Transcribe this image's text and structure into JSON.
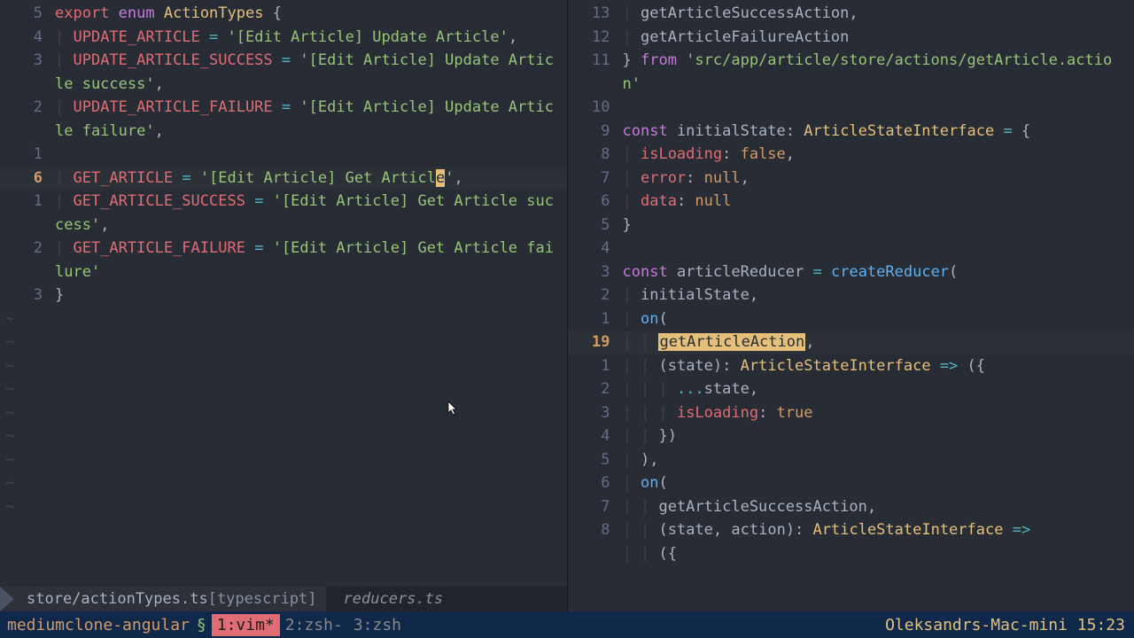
{
  "left": {
    "lines": [
      {
        "n": "5",
        "cur": false,
        "tokens": [
          [
            "kw-export",
            "export"
          ],
          [
            "punct",
            " "
          ],
          [
            "kw-enum",
            "enum"
          ],
          [
            "punct",
            " "
          ],
          [
            "type-name",
            "ActionTypes"
          ],
          [
            "punct",
            " {"
          ]
        ]
      },
      {
        "n": "4",
        "cur": false,
        "indent": 1,
        "tokens": [
          [
            "member",
            "UPDATE_ARTICLE"
          ],
          [
            "punct",
            " "
          ],
          [
            "op",
            "="
          ],
          [
            "punct",
            " "
          ],
          [
            "string",
            "'[Edit Article] Update Article'"
          ],
          [
            "punct",
            ","
          ]
        ]
      },
      {
        "n": "3",
        "cur": false,
        "indent": 1,
        "tokens": [
          [
            "member",
            "UPDATE_ARTICLE_SUCCESS"
          ],
          [
            "punct",
            " "
          ],
          [
            "op",
            "="
          ],
          [
            "punct",
            " "
          ],
          [
            "string",
            "'[Edit Article] Update Article success'"
          ],
          [
            "punct",
            ","
          ]
        ]
      },
      {
        "n": "2",
        "cur": false,
        "indent": 1,
        "tokens": [
          [
            "member",
            "UPDATE_ARTICLE_FAILURE"
          ],
          [
            "punct",
            " "
          ],
          [
            "op",
            "="
          ],
          [
            "punct",
            " "
          ],
          [
            "string",
            "'[Edit Article] Update Article failure'"
          ],
          [
            "punct",
            ","
          ]
        ]
      },
      {
        "n": "1",
        "cur": false,
        "indent": 0,
        "tokens": []
      },
      {
        "n": "6",
        "cur": true,
        "indent": 1,
        "tokens": [
          [
            "member",
            "GET_ARTICLE"
          ],
          [
            "punct",
            " "
          ],
          [
            "op",
            "="
          ],
          [
            "punct",
            " "
          ],
          [
            "string",
            "'[Edit Article] Get Articl"
          ],
          [
            "highlight-char",
            "e"
          ],
          [
            "string",
            "'"
          ],
          [
            "punct",
            ","
          ]
        ]
      },
      {
        "n": "1",
        "cur": false,
        "indent": 1,
        "tokens": [
          [
            "member",
            "GET_ARTICLE_SUCCESS"
          ],
          [
            "punct",
            " "
          ],
          [
            "op",
            "="
          ],
          [
            "punct",
            " "
          ],
          [
            "string",
            "'[Edit Article] Get Article success'"
          ],
          [
            "punct",
            ","
          ]
        ]
      },
      {
        "n": "2",
        "cur": false,
        "indent": 1,
        "tokens": [
          [
            "member",
            "GET_ARTICLE_FAILURE"
          ],
          [
            "punct",
            " "
          ],
          [
            "op",
            "="
          ],
          [
            "punct",
            " "
          ],
          [
            "string",
            "'[Edit Article] Get Article failure'"
          ]
        ]
      },
      {
        "n": "3",
        "cur": false,
        "indent": 0,
        "tokens": [
          [
            "punct",
            "}"
          ]
        ]
      }
    ],
    "tildes": 9,
    "status_file": "store/actionTypes.ts",
    "status_filetype": "[typescript]"
  },
  "right": {
    "lines": [
      {
        "n": "13",
        "indent": 1,
        "tokens": [
          [
            "ident",
            "getArticleSuccessAction"
          ],
          [
            "punct",
            ","
          ]
        ]
      },
      {
        "n": "12",
        "indent": 1,
        "tokens": [
          [
            "ident",
            "getArticleFailureAction"
          ]
        ]
      },
      {
        "n": "11",
        "indent": 0,
        "tokens": [
          [
            "punct",
            "} "
          ],
          [
            "kw-from",
            "from"
          ],
          [
            "punct",
            " "
          ],
          [
            "string",
            "'src/app/article/store/actions/getArticle.action'"
          ]
        ]
      },
      {
        "n": "10",
        "indent": 0,
        "tokens": []
      },
      {
        "n": "9",
        "indent": 0,
        "tokens": [
          [
            "kw-const",
            "const"
          ],
          [
            "punct",
            " "
          ],
          [
            "ident",
            "initialState"
          ],
          [
            "punct",
            ": "
          ],
          [
            "type-name",
            "ArticleStateInterface"
          ],
          [
            "punct",
            " "
          ],
          [
            "op",
            "="
          ],
          [
            "punct",
            " {"
          ]
        ]
      },
      {
        "n": "8",
        "indent": 1,
        "tokens": [
          [
            "member",
            "isLoading"
          ],
          [
            "punct",
            ": "
          ],
          [
            "kw-false",
            "false"
          ],
          [
            "punct",
            ","
          ]
        ]
      },
      {
        "n": "7",
        "indent": 1,
        "tokens": [
          [
            "member",
            "error"
          ],
          [
            "punct",
            ": "
          ],
          [
            "kw-null",
            "null"
          ],
          [
            "punct",
            ","
          ]
        ]
      },
      {
        "n": "6",
        "indent": 1,
        "tokens": [
          [
            "member",
            "data"
          ],
          [
            "punct",
            ": "
          ],
          [
            "kw-null",
            "null"
          ]
        ]
      },
      {
        "n": "5",
        "indent": 0,
        "tokens": [
          [
            "punct",
            "}"
          ]
        ]
      },
      {
        "n": "4",
        "indent": 0,
        "tokens": []
      },
      {
        "n": "3",
        "indent": 0,
        "tokens": [
          [
            "kw-const",
            "const"
          ],
          [
            "punct",
            " "
          ],
          [
            "ident",
            "articleReducer"
          ],
          [
            "punct",
            " "
          ],
          [
            "op",
            "="
          ],
          [
            "punct",
            " "
          ],
          [
            "func",
            "createReducer"
          ],
          [
            "punct",
            "("
          ]
        ]
      },
      {
        "n": "2",
        "indent": 1,
        "tokens": [
          [
            "ident",
            "initialState"
          ],
          [
            "punct",
            ","
          ]
        ]
      },
      {
        "n": "1",
        "indent": 1,
        "tokens": [
          [
            "func",
            "on"
          ],
          [
            "punct",
            "("
          ]
        ]
      },
      {
        "n": "19",
        "cur": true,
        "indent": 2,
        "tokens": [
          [
            "highlight-word",
            "getArticleAction"
          ],
          [
            "punct",
            ","
          ]
        ]
      },
      {
        "n": "1",
        "indent": 2,
        "tokens": [
          [
            "punct",
            "("
          ],
          [
            "ident",
            "state"
          ],
          [
            "punct",
            "): "
          ],
          [
            "type-name",
            "ArticleStateInterface"
          ],
          [
            "punct",
            " "
          ],
          [
            "op",
            "=>"
          ],
          [
            "punct",
            " ({"
          ]
        ]
      },
      {
        "n": "2",
        "indent": 3,
        "tokens": [
          [
            "op",
            "..."
          ],
          [
            "ident",
            "state"
          ],
          [
            "punct",
            ","
          ]
        ]
      },
      {
        "n": "3",
        "indent": 3,
        "tokens": [
          [
            "member",
            "isLoading"
          ],
          [
            "punct",
            ": "
          ],
          [
            "kw-true",
            "true"
          ]
        ]
      },
      {
        "n": "4",
        "indent": 2,
        "tokens": [
          [
            "punct",
            "})"
          ]
        ]
      },
      {
        "n": "5",
        "indent": 1,
        "tokens": [
          [
            "punct",
            "),"
          ]
        ]
      },
      {
        "n": "6",
        "indent": 1,
        "tokens": [
          [
            "func",
            "on"
          ],
          [
            "punct",
            "("
          ]
        ]
      },
      {
        "n": "7",
        "indent": 2,
        "tokens": [
          [
            "ident",
            "getArticleSuccessAction"
          ],
          [
            "punct",
            ","
          ]
        ]
      },
      {
        "n": "8",
        "indent": 2,
        "tokens": [
          [
            "punct",
            "("
          ],
          [
            "ident",
            "state"
          ],
          [
            "punct",
            ", "
          ],
          [
            "ident",
            "action"
          ],
          [
            "punct",
            "): "
          ],
          [
            "type-name",
            "ArticleStateInterface"
          ],
          [
            "punct",
            " "
          ],
          [
            "op",
            "=>"
          ],
          [
            "punct",
            " "
          ]
        ]
      },
      {
        "n": "",
        "indent": 2,
        "tokens": [
          [
            "punct",
            "({"
          ]
        ]
      }
    ],
    "status_file": "reducers.ts"
  },
  "tmux": {
    "session": "mediumclone-angular",
    "sep": "§",
    "active": "1:vim*",
    "w2": "2:zsh-",
    "w3": "3:zsh",
    "right": "Oleksandrs-Mac-mini  15:23"
  }
}
